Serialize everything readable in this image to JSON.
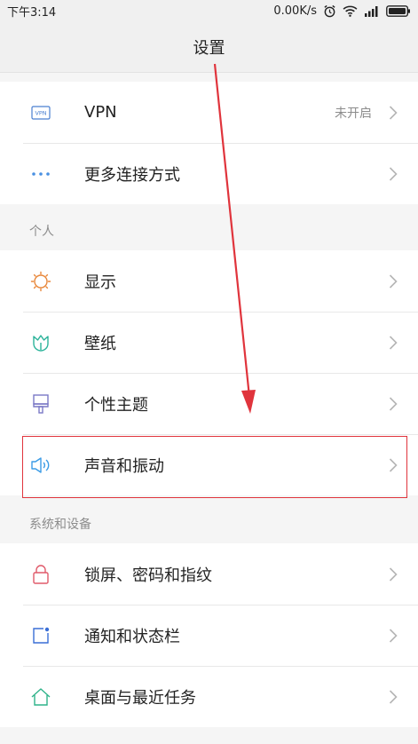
{
  "status_bar": {
    "time": "下午3:14",
    "net_speed": "0.00K/s"
  },
  "header": {
    "title": "设置"
  },
  "groups": {
    "network": [
      {
        "label": "VPN",
        "value": "未开启",
        "icon": "vpn-icon"
      },
      {
        "label": "更多连接方式",
        "icon": "more-dots-icon"
      }
    ],
    "personal_header": "个人",
    "personal": [
      {
        "label": "显示",
        "icon": "sun-icon"
      },
      {
        "label": "壁纸",
        "icon": "tulip-icon"
      },
      {
        "label": "个性主题",
        "icon": "brush-icon"
      },
      {
        "label": "声音和振动",
        "icon": "speaker-icon"
      }
    ],
    "system_header": "系统和设备",
    "system": [
      {
        "label": "锁屏、密码和指纹",
        "icon": "lock-icon"
      },
      {
        "label": "通知和状态栏",
        "icon": "notification-icon"
      },
      {
        "label": "桌面与最近任务",
        "icon": "home-icon"
      }
    ]
  },
  "colors": {
    "annotation_red": "#e0343c",
    "vpn_icon": "#4a7fd0",
    "dots_icon": "#4a90e2",
    "sun_icon": "#e8873a",
    "tulip_icon": "#2bb39a",
    "brush_icon": "#7b79c6",
    "speaker_icon": "#3b9be6",
    "lock_icon": "#e05a6a",
    "notification_icon": "#3a6fd6",
    "home_icon": "#2fb38a"
  }
}
